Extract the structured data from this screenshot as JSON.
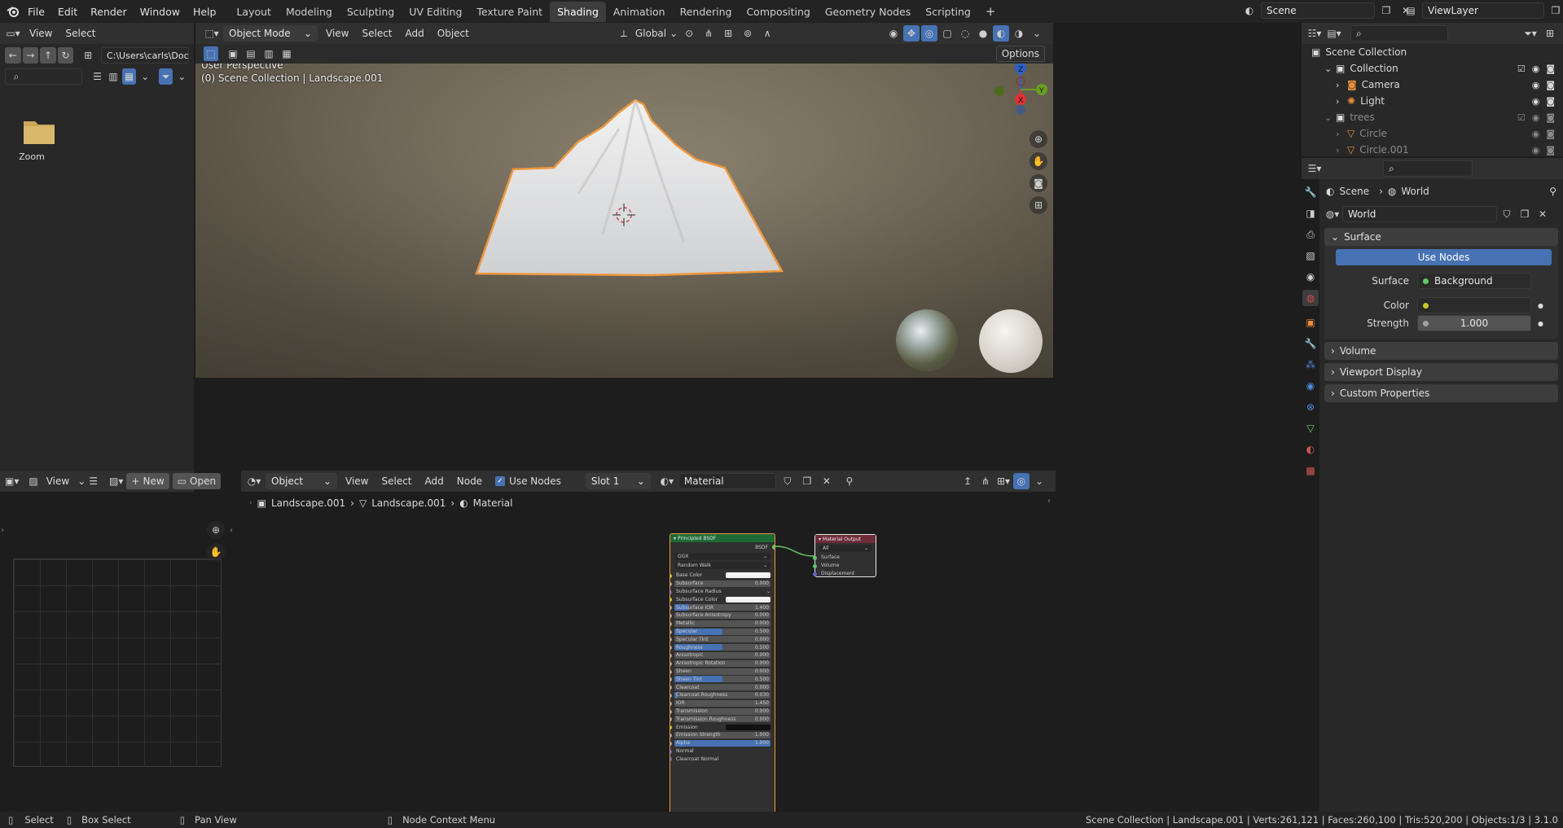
{
  "topbar": {
    "menus": [
      "File",
      "Edit",
      "Render",
      "Window",
      "Help"
    ],
    "workspaces": [
      "Layout",
      "Modeling",
      "Sculpting",
      "UV Editing",
      "Texture Paint",
      "Shading",
      "Animation",
      "Rendering",
      "Compositing",
      "Geometry Nodes",
      "Scripting"
    ],
    "active_workspace": "Shading",
    "add_symbol": "+",
    "scene": "Scene",
    "view_layer": "ViewLayer"
  },
  "file_browser": {
    "menu_view": "View",
    "menu_select": "Select",
    "path": "C:\\Users\\carls\\Docum...",
    "folder_name": "Zoom"
  },
  "viewport": {
    "mode": "Object Mode",
    "menus": [
      "View",
      "Select",
      "Add",
      "Object"
    ],
    "transform": "Global",
    "options": "Options",
    "perspective": "User Perspective",
    "context": "(0) Scene Collection | Landscape.001",
    "gizmo": {
      "z": "Z",
      "y": "Y",
      "x": "X"
    }
  },
  "image_editor": {
    "view": "View",
    "new": "New",
    "open": "Open"
  },
  "node_editor": {
    "type": "Object",
    "menus": [
      "View",
      "Select",
      "Add",
      "Node"
    ],
    "use_nodes": "Use Nodes",
    "slot": "Slot 1",
    "material": "Material",
    "breadcrumb": [
      "Landscape.001",
      "Landscape.001",
      "Material"
    ],
    "bsdf_title": "Principled BSDF",
    "bsdf_output": "BSDF",
    "bsdf_dropdowns": [
      "GGX",
      "Random Walk"
    ],
    "bsdf_rows": [
      {
        "label": "Base Color",
        "type": "color",
        "value": ""
      },
      {
        "label": "Subsurface",
        "type": "value",
        "value": "0.000",
        "fill": 0
      },
      {
        "label": "Subsurface Radius",
        "type": "dropdown",
        "value": ""
      },
      {
        "label": "Subsurface Color",
        "type": "color",
        "value": ""
      },
      {
        "label": "Subsurface IOR",
        "type": "value",
        "value": "1.400",
        "fill": 0.15
      },
      {
        "label": "Subsurface Anisotropy",
        "type": "value",
        "value": "0.000",
        "fill": 0
      },
      {
        "label": "Metallic",
        "type": "value",
        "value": "0.000",
        "fill": 0
      },
      {
        "label": "Specular",
        "type": "value",
        "value": "0.500",
        "fill": 0.5
      },
      {
        "label": "Specular Tint",
        "type": "value",
        "value": "0.000",
        "fill": 0
      },
      {
        "label": "Roughness",
        "type": "value",
        "value": "0.500",
        "fill": 0.5
      },
      {
        "label": "Anisotropic",
        "type": "value",
        "value": "0.000",
        "fill": 0
      },
      {
        "label": "Anisotropic Rotation",
        "type": "value",
        "value": "0.000",
        "fill": 0
      },
      {
        "label": "Sheen",
        "type": "value",
        "value": "0.000",
        "fill": 0
      },
      {
        "label": "Sheen Tint",
        "type": "value",
        "value": "0.500",
        "fill": 0.5
      },
      {
        "label": "Clearcoat",
        "type": "value",
        "value": "0.000",
        "fill": 0
      },
      {
        "label": "Clearcoat Roughness",
        "type": "value",
        "value": "0.030",
        "fill": 0.03
      },
      {
        "label": "IOR",
        "type": "value",
        "value": "1.450",
        "fill": 0
      },
      {
        "label": "Transmission",
        "type": "value",
        "value": "0.000",
        "fill": 0
      },
      {
        "label": "Transmission Roughness",
        "type": "value",
        "value": "0.000",
        "fill": 0
      },
      {
        "label": "Emission",
        "type": "color-black",
        "value": ""
      },
      {
        "label": "Emission Strength",
        "type": "value",
        "value": "1.000",
        "fill": 0
      },
      {
        "label": "Alpha",
        "type": "value",
        "value": "1.000",
        "fill": 1
      },
      {
        "label": "Normal",
        "type": "plain",
        "value": ""
      },
      {
        "label": "Clearcoat Normal",
        "type": "plain",
        "value": ""
      }
    ],
    "output_title": "Material Output",
    "output_target": "All",
    "output_inputs": [
      "Surface",
      "Volume",
      "Displacement"
    ]
  },
  "outliner": {
    "root": "Scene Collection",
    "items": [
      {
        "name": "Collection",
        "depth": 1,
        "icon": "collection",
        "checked": true
      },
      {
        "name": "Camera",
        "depth": 2,
        "icon": "camera"
      },
      {
        "name": "Light",
        "depth": 2,
        "icon": "light"
      },
      {
        "name": "trees",
        "depth": 1,
        "icon": "collection",
        "checked": true,
        "dim": true
      },
      {
        "name": "Circle",
        "depth": 2,
        "icon": "mesh",
        "dim": true
      },
      {
        "name": "Circle.001",
        "depth": 2,
        "icon": "mesh",
        "dim": true
      }
    ]
  },
  "properties": {
    "breadcrumb_scene": "Scene",
    "breadcrumb_world": "World",
    "world_name": "World",
    "surface_section": "Surface",
    "use_nodes": "Use Nodes",
    "surface_label": "Surface",
    "surface_value": "Background",
    "color_label": "Color",
    "strength_label": "Strength",
    "strength_value": "1.000",
    "sections": [
      "Volume",
      "Viewport Display",
      "Custom Properties"
    ]
  },
  "statusbar": {
    "select": "Select",
    "box_select": "Box Select",
    "pan_view": "Pan View",
    "node_context": "Node Context Menu",
    "stats": "Scene Collection | Landscape.001 | Verts:261,121 | Faces:260,100 | Tris:520,200 | Objects:1/3 | 3.1.0"
  },
  "colors": {
    "accent": "#4772b3",
    "selection": "#f0973d",
    "bsdf_header": "#1e6a35",
    "output_header": "#6e2c38"
  }
}
